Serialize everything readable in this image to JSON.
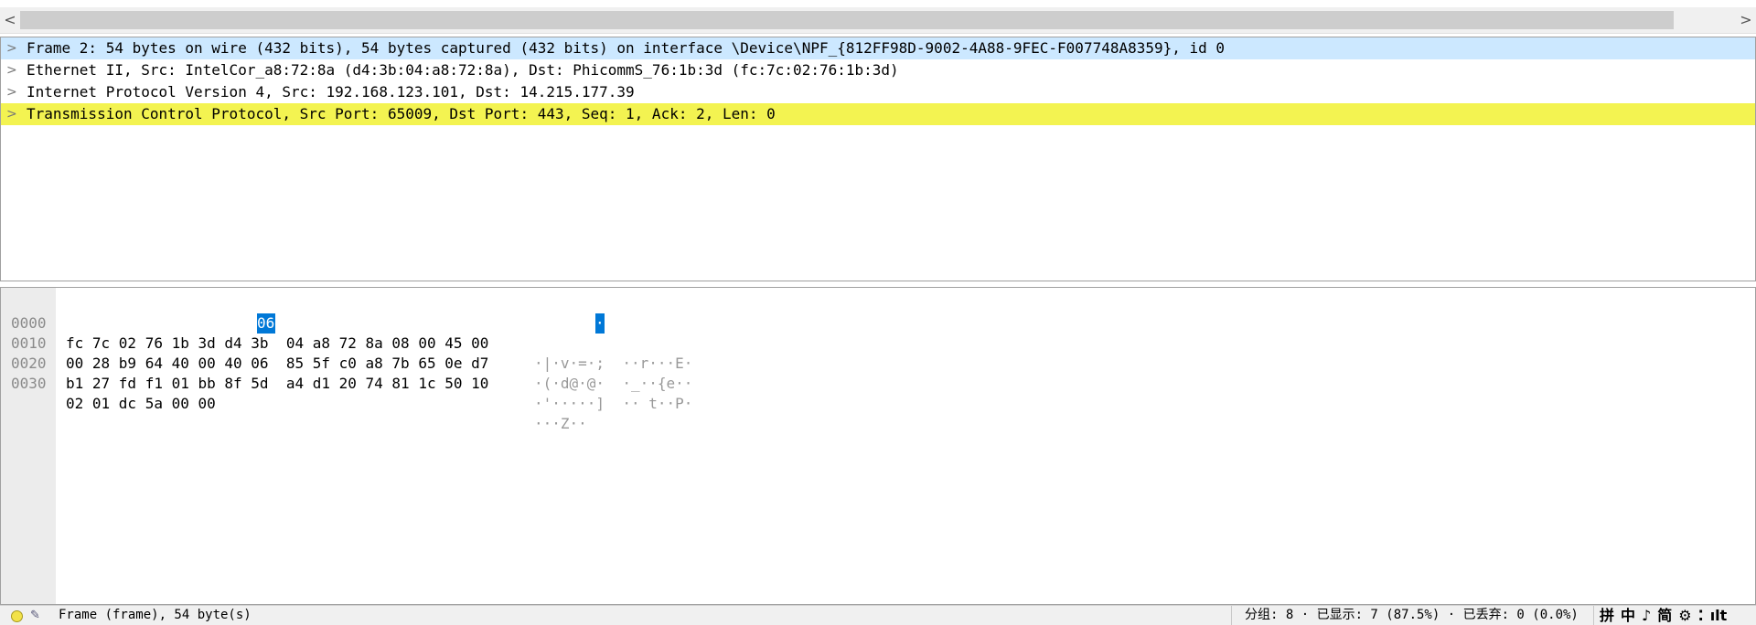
{
  "packet_details": {
    "rows": [
      {
        "text": "Frame 2: 54 bytes on wire (432 bits), 54 bytes captured (432 bits) on interface \\Device\\NPF_{812FF98D-9002-4A88-9FEC-F007748A8359}, id 0"
      },
      {
        "text": "Ethernet II, Src: IntelCor_a8:72:8a (d4:3b:04:a8:72:8a), Dst: PhicommS_76:1b:3d (fc:7c:02:76:1b:3d)"
      },
      {
        "text": "Internet Protocol Version 4, Src: 192.168.123.101, Dst: 14.215.177.39"
      },
      {
        "text": "Transmission Control Protocol, Src Port: 65009, Dst Port: 443, Seq: 1, Ack: 2, Len: 0"
      }
    ],
    "caret_icon": "chevron-right-icon",
    "selected_color": "#cce8ff",
    "highlight_color": "#f3f351"
  },
  "bytes_pane": {
    "rows": [
      {
        "offset": "0000",
        "hex_a": "fc 7c 02 76 1b 3d d4 3b",
        "hex_b": "04 a8 72 8a 08 00 45 00",
        "ascii": "·|·v·=·;  ··r···E·"
      },
      {
        "offset": "0010",
        "hex_a": "00 28 b9 64 40 00 40 06",
        "hex_b": "85 5f c0 a8 7b 65 0e d7",
        "ascii": "·(·d@·@·  ·_··{e··"
      },
      {
        "offset": "0020",
        "hex_a": "b1 27 fd f1 01 bb 8f 5d",
        "hex_b": "a4 d1 20 74 81 1c 50 10",
        "ascii": "·'·····]  ·· t··P·"
      },
      {
        "offset": "0030",
        "hex_a": "02 01 dc 5a 00 00",
        "hex_b": "",
        "ascii": "···Z··"
      }
    ],
    "selected_byte": "06",
    "selected_ascii": "·",
    "selection_color": "#0078d7"
  },
  "status_bar": {
    "left_text": "Frame (frame), 54 byte(s)",
    "right_text": "分组: 8 · 已显示: 7 (87.5%) · 已丢弃: 0 (0.0%)",
    "ime_items": [
      "拼",
      "中",
      "♪",
      "简",
      "⚙",
      "⁚",
      "ılt"
    ],
    "led_icon": "status-led-icon",
    "edit_icon": "edit-comment-icon"
  }
}
